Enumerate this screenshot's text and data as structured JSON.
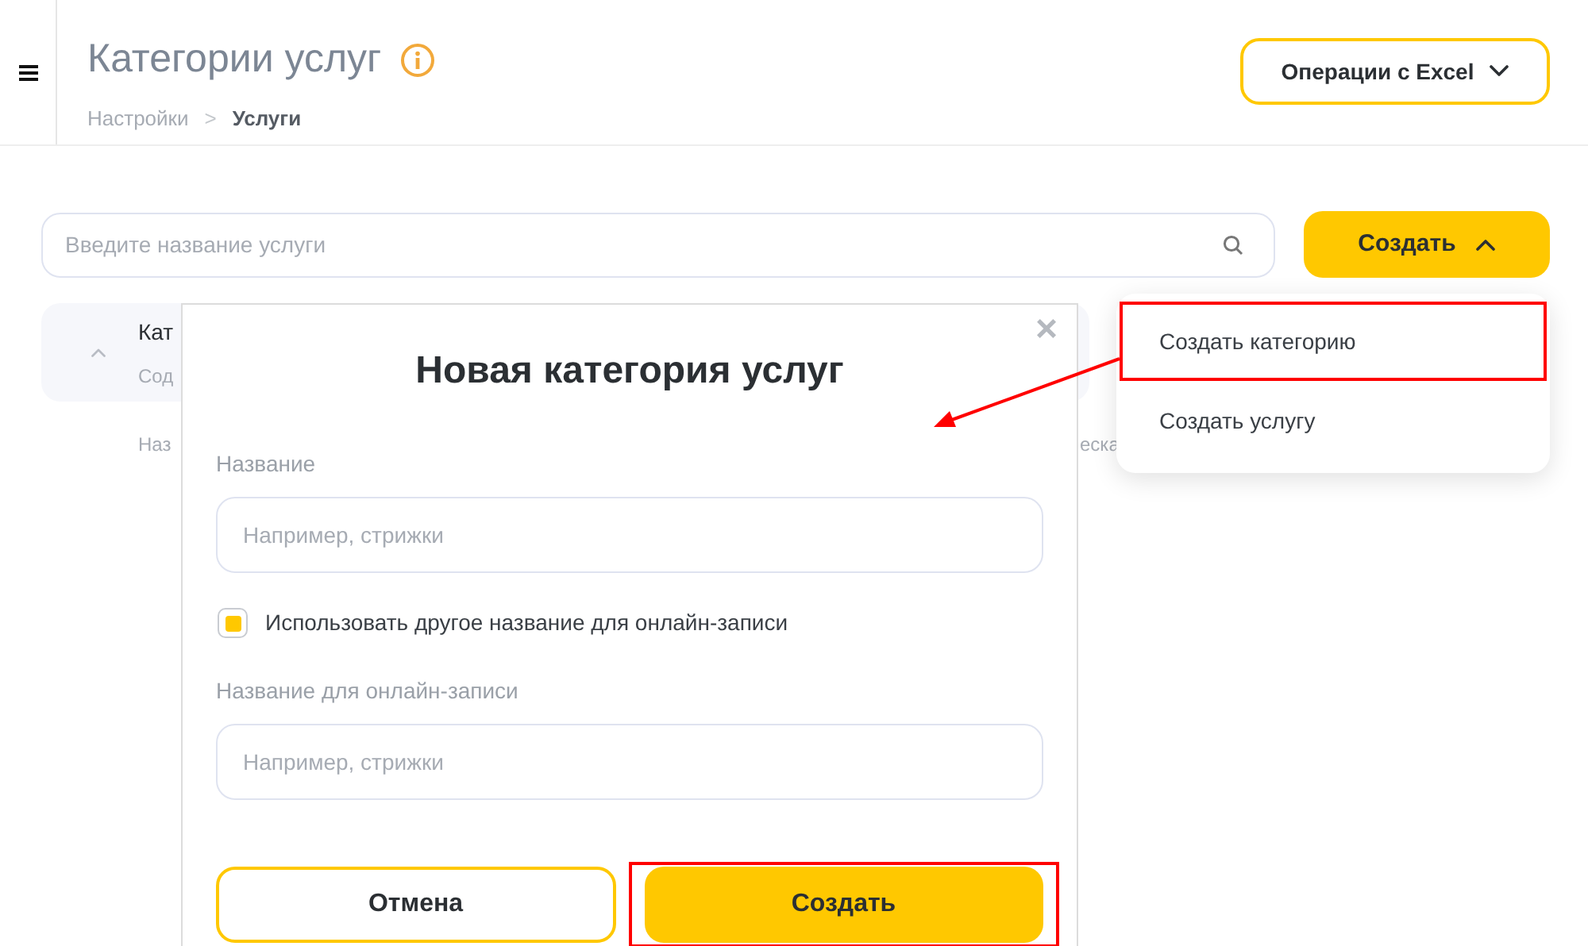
{
  "header": {
    "title": "Категории услуг",
    "breadcrumbs": [
      {
        "label": "Настройки"
      },
      {
        "label": "Услуги"
      }
    ],
    "breadcrumb_separator": ">",
    "excel_button": "Операции с Excel"
  },
  "search": {
    "placeholder": "Введите название услуги"
  },
  "create_button": {
    "label": "Создать",
    "expanded": true
  },
  "category_row": {
    "title_fragment": "Кат",
    "subtitle_fragment": "Сод",
    "column_fragments": [
      "Наз",
      "еска"
    ]
  },
  "dropdown": {
    "items": [
      {
        "label": "Создать категорию",
        "annotated": true
      },
      {
        "label": "Создать услугу",
        "annotated": false
      }
    ]
  },
  "modal": {
    "title": "Новая категория услуг",
    "close": "×",
    "name_field": {
      "label": "Название",
      "placeholder": "Например, стрижки"
    },
    "checkbox": {
      "label": "Использовать другое название для онлайн-записи",
      "checked": true
    },
    "online_field": {
      "label": "Название для онлайн-записи",
      "placeholder": "Например, стрижки"
    },
    "buttons": [
      {
        "label": "Отмена",
        "kind": "secondary",
        "annotated": false
      },
      {
        "label": "Создать",
        "kind": "primary",
        "annotated": true
      }
    ]
  }
}
